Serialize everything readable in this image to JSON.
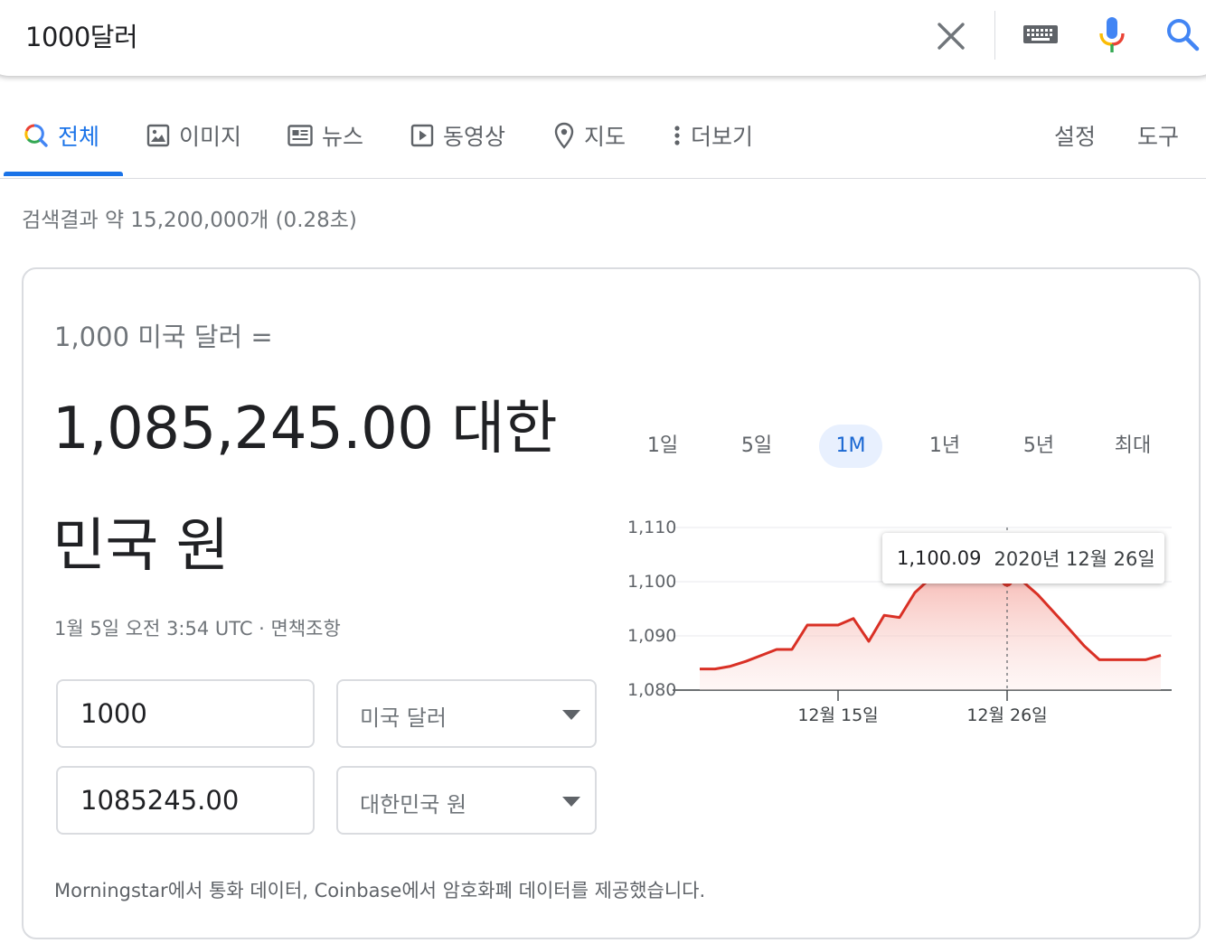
{
  "search": {
    "query": "1000달러"
  },
  "tabs": [
    {
      "label": "전체",
      "active": true
    },
    {
      "label": "이미지"
    },
    {
      "label": "뉴스"
    },
    {
      "label": "동영상"
    },
    {
      "label": "지도"
    },
    {
      "label": "더보기"
    }
  ],
  "tools": {
    "settings": "설정",
    "tools": "도구"
  },
  "result_stats": "검색결과 약 15,200,000개 (0.28초)",
  "converter": {
    "from_label": "1,000 미국 달러 =",
    "to_value_line1": "1,085,245.00 대한",
    "to_value_line2": "민국 원",
    "timestamp": "1월 5일 오전 3:54 UTC",
    "separator": " · ",
    "disclaimer": "면책조항",
    "amount_from": "1000",
    "currency_from": "미국 달러",
    "amount_to": "1085245.00",
    "currency_to": "대한민국 원",
    "source_note": "Morningstar에서 통화 데이터, Coinbase에서 암호화폐 데이터를 제공했습니다."
  },
  "range_tabs": [
    "1일",
    "5일",
    "1M",
    "1년",
    "5년",
    "최대"
  ],
  "active_range": "1M",
  "colors": {
    "accent": "#1a73e8",
    "line": "#d93025",
    "fill": "#fce8e6"
  },
  "chart_data": {
    "type": "area",
    "title": "",
    "xlabel": "",
    "ylabel": "",
    "ylim": [
      1080,
      1110
    ],
    "yticks": [
      1080,
      1090,
      1100,
      1110
    ],
    "ytick_labels": [
      "1,080",
      "1,090",
      "1,100",
      "1,110"
    ],
    "xtick_labels": [
      "12월 15일",
      "12월 26일"
    ],
    "xtick_index": [
      9,
      20
    ],
    "values": [
      1083.9,
      1083.9,
      1084.4,
      1085.3,
      1086.4,
      1087.5,
      1087.5,
      1092.0,
      1092.0,
      1092.0,
      1093.2,
      1089.0,
      1093.8,
      1093.4,
      1098.0,
      1100.6,
      1100.6,
      1100.6,
      1102.0,
      1102.0,
      1100.09,
      1100.09,
      1097.6,
      1094.5,
      1091.4,
      1088.2,
      1085.6,
      1085.6,
      1085.6,
      1085.6,
      1086.4
    ],
    "highlight": {
      "index": 20,
      "value": "1,100.09",
      "date": "2020년 12월 26일"
    },
    "grid": true,
    "legend": "none"
  }
}
